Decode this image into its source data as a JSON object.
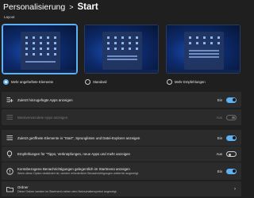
{
  "breadcrumb": {
    "parent": "Personalisierung",
    "separator": ">",
    "current": "Start"
  },
  "layout": {
    "section_title": "Layout",
    "options": [
      {
        "label": "Mehr angeheftete Elemente",
        "selected": true
      },
      {
        "label": "Standard",
        "selected": false
      },
      {
        "label": "Mehr Empfehlungen",
        "selected": false
      }
    ]
  },
  "settings": [
    {
      "label": "Zuletzt hinzugefügte Apps anzeigen",
      "state": "Ein",
      "toggle": "on",
      "icon": "list-plus-icon"
    },
    {
      "label": "Meistverwendete Apps anzeigen",
      "state": "Aus",
      "toggle": "disabled",
      "icon": "list-icon"
    },
    {
      "label": "Zuletzt geöffnete Elemente in \"Start\", Sprunglisten und Datei-Explorer anzeigen",
      "state": "Ein",
      "toggle": "on",
      "icon": "recent-list-icon"
    },
    {
      "label": "Empfehlungen für \"Tipps, Verknüpfungen, neue Apps und mehr anzeigen",
      "state": "Aus",
      "toggle": "off",
      "icon": "lightbulb-icon"
    },
    {
      "label": "Kontobezogene Benachrichtigungen gelegentlich im Startmenü anzeigen",
      "description": "Wenn diese Option deaktiviert ist, werden erforderliche Benachrichtigungen weiterhin angezeigt.",
      "state": "Ein",
      "toggle": "on",
      "icon": "account-notification-icon"
    },
    {
      "label": "Ordner",
      "description": "Diese Ordner werden im Startmenü neben dem Netzschaltersymbol angezeigt.",
      "icon": "folder-icon",
      "chevron": "chevron-right-icon"
    }
  ],
  "colors": {
    "accent": "#5fb2f2",
    "background": "#1f1f1f",
    "card": "#2b2b2b"
  }
}
